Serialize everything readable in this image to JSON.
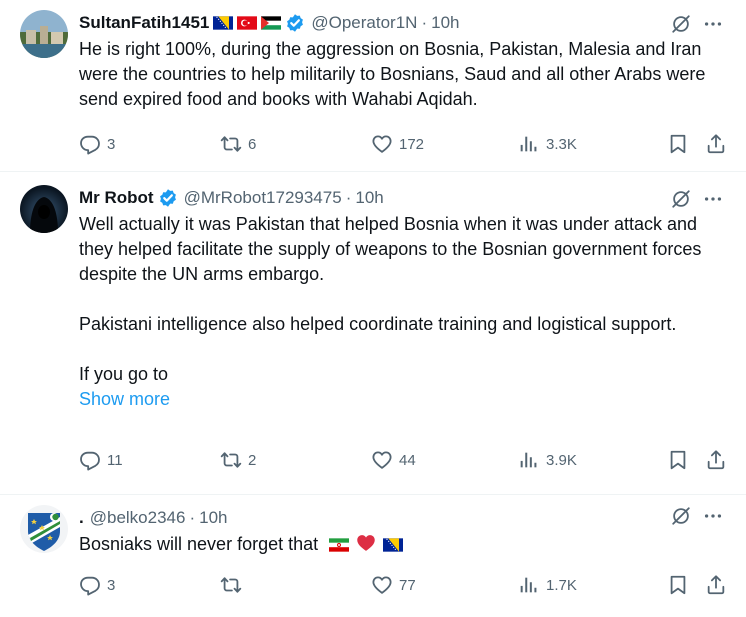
{
  "colors": {
    "text": "#0f1419",
    "secondary": "#536471",
    "link": "#1d9bf0",
    "verified": "#1d9bf0",
    "divider": "#eff3f4"
  },
  "tweets": [
    {
      "name": "SultanFatih1451",
      "flags": [
        "Bosnia and Herzegovina",
        "Türkiye",
        "Palestine"
      ],
      "verified": true,
      "handle": "@Operator1N",
      "separator": "·",
      "time": "10h",
      "paragraphs": [
        "He is right 100%, during the aggression on Bosnia, Pakistan, Malesia and Iran were the countries to help militarily to Bosnians, Saud and all other Arabs were send expired food and books with Wahabi Aqidah."
      ],
      "reply_count": "3",
      "repost_count": "6",
      "like_count": "172",
      "view_count": "3.3K"
    },
    {
      "name": "Mr Robot",
      "verified": true,
      "handle": "@MrRobot17293475",
      "separator": "·",
      "time": "10h",
      "paragraphs": [
        "Well actually it was Pakistan that helped Bosnia when it was under attack and they helped facilitate the supply of weapons to the Bosnian government forces despite the UN arms embargo.",
        "Pakistani intelligence also helped coordinate training and logistical support.",
        "If you go to"
      ],
      "show_more": "Show more",
      "reply_count": "11",
      "repost_count": "2",
      "like_count": "44",
      "view_count": "3.9K"
    },
    {
      "name": ".",
      "verified": false,
      "handle": "@belko2346",
      "separator": "·",
      "time": "10h",
      "text": "Bosniaks will never forget that",
      "emoji": [
        "Iran flag",
        "red heart",
        "Bosnia and Herzegovina flag"
      ],
      "reply_count": "3",
      "repost_count": "",
      "like_count": "77",
      "view_count": "1.7K"
    }
  ],
  "icons": {
    "reply": "reply-icon",
    "repost": "repost-icon",
    "like": "heart-icon",
    "views": "views-icon",
    "bookmark": "bookmark-icon",
    "share": "share-icon",
    "grok": "grok-icon",
    "more": "more-icon"
  }
}
